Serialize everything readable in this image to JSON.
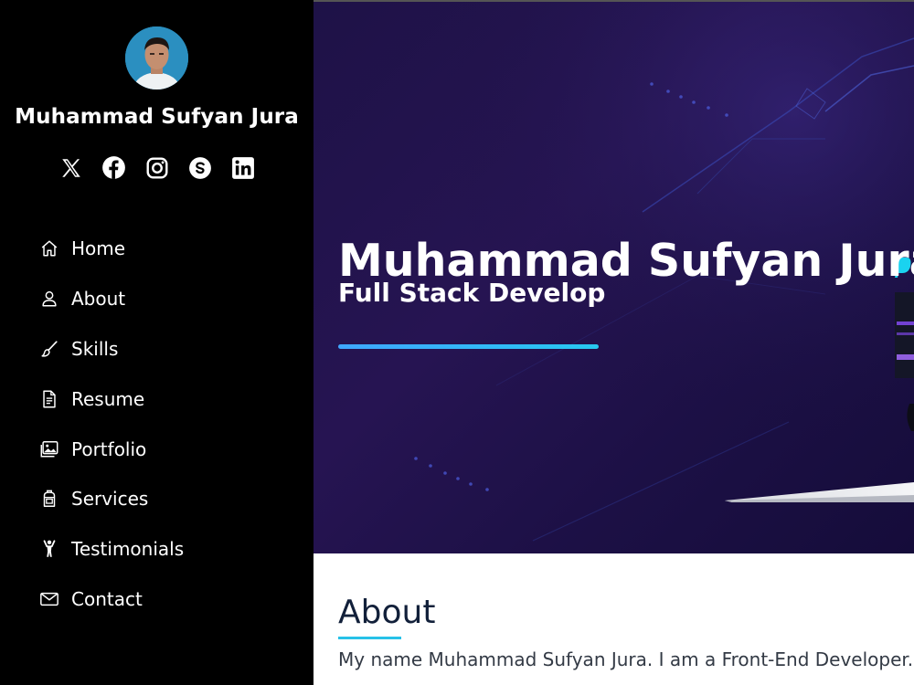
{
  "profile": {
    "name": "Muhammad Sufyan Jura"
  },
  "social": [
    {
      "icon": "x-twitter-icon"
    },
    {
      "icon": "facebook-icon"
    },
    {
      "icon": "instagram-icon"
    },
    {
      "icon": "skype-icon"
    },
    {
      "icon": "linkedin-icon"
    }
  ],
  "nav": {
    "items": [
      {
        "label": "Home",
        "icon": "house-icon"
      },
      {
        "label": "About",
        "icon": "person-icon"
      },
      {
        "label": "Skills",
        "icon": "brush-icon"
      },
      {
        "label": "Resume",
        "icon": "file-text-icon"
      },
      {
        "label": "Portfolio",
        "icon": "images-icon"
      },
      {
        "label": "Services",
        "icon": "backpack-icon"
      },
      {
        "label": "Testimonials",
        "icon": "person-arms-up-icon"
      },
      {
        "label": "Contact",
        "icon": "envelope-icon"
      }
    ]
  },
  "hero": {
    "title": "Muhammad Sufyan Jura",
    "subtitle": "Full Stack Develop"
  },
  "about": {
    "title": "About",
    "text": "My name Muhammad Sufyan Jura. I am a Front-End Developer. M"
  },
  "colors": {
    "sidebar_bg": "#000000",
    "hero_bg": "#1e1247",
    "accent": "#27c1e8"
  }
}
